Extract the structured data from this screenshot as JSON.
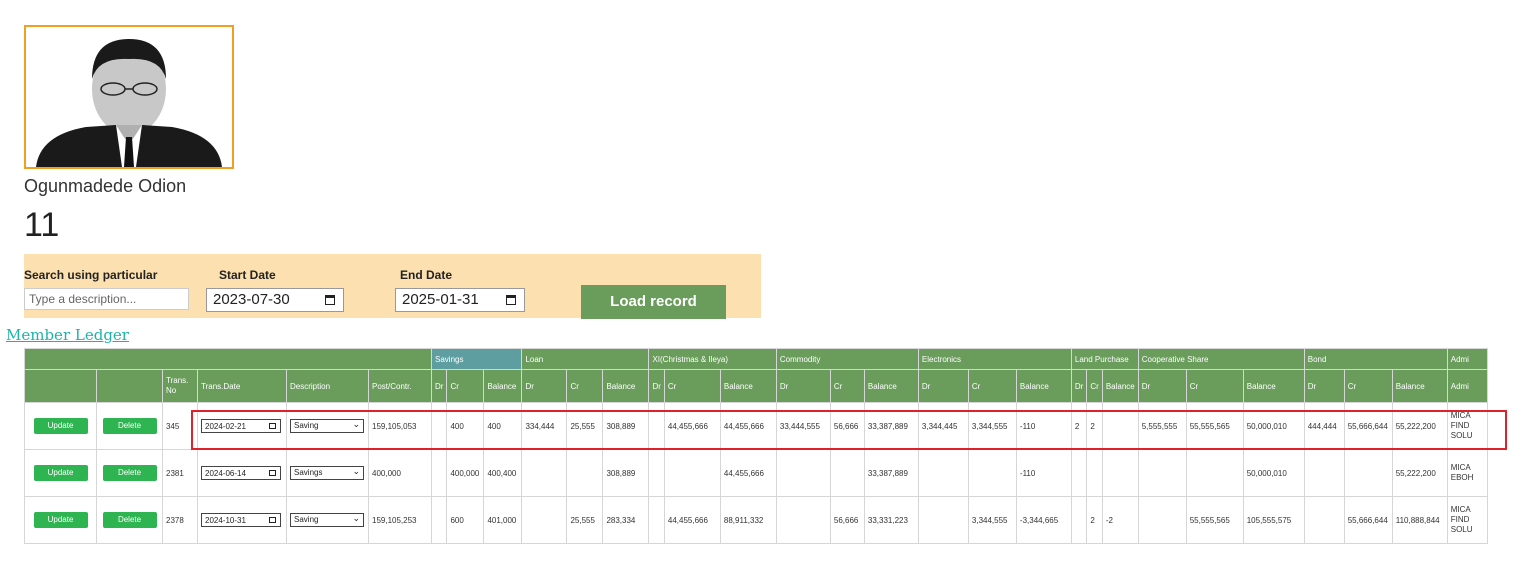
{
  "member": {
    "name": "Ogunmadede Odion",
    "id": "11"
  },
  "filters": {
    "search_label": "Search using particular",
    "search_placeholder": "Type a description...",
    "start_label": "Start Date",
    "start_value": "2023-07-30",
    "end_label": "End Date",
    "end_value": "2025-01-31",
    "load_label": "Load record"
  },
  "ledger_link": "Member Ledger",
  "table": {
    "group_headers": {
      "savings": "Savings",
      "loan": "Loan",
      "xi": "XI(Christmas & Ileya)",
      "commodity": "Commodity",
      "electronics": "Electronics",
      "land": "Land Purchase",
      "coop": "Cooperative Share",
      "bond": "Bond",
      "admin": "Admi"
    },
    "col_headers": {
      "trans_no": "Trans. No",
      "trans_date": "Trans.Date",
      "description": "Description",
      "post": "Post/Contr.",
      "dr": "Dr",
      "cr": "Cr",
      "balance": "Balance",
      "admin": "Admi"
    },
    "update_label": "Update",
    "delete_label": "Delete",
    "rows": [
      {
        "trans_no": "345",
        "date": "2024-02-21",
        "desc": "Saving",
        "post": "159,105,053",
        "sav_dr": "",
        "sav_cr": "400",
        "sav_bal": "400",
        "loan_dr": "334,444",
        "loan_cr": "25,555",
        "loan_bal": "308,889",
        "xi_dr": "",
        "xi_cr": "44,455,666",
        "xi_bal": "44,455,666",
        "com_dr": "33,444,555",
        "com_cr": "56,666",
        "com_bal": "33,387,889",
        "ele_dr": "3,344,445",
        "ele_cr": "3,344,555",
        "ele_bal": "-110",
        "land_dr": "2",
        "land_cr": "2",
        "land_bal": "",
        "coop_dr": "5,555,555",
        "coop_cr": "55,555,565",
        "coop_bal": "50,000,010",
        "bond_dr": "444,444",
        "bond_cr": "55,666,644",
        "bond_bal": "55,222,200",
        "admin": "MICA FIND SOLU"
      },
      {
        "trans_no": "2381",
        "date": "2024-06-14",
        "desc": "Savings",
        "post": "400,000",
        "sav_dr": "",
        "sav_cr": "400,000",
        "sav_bal": "400,400",
        "loan_dr": "",
        "loan_cr": "",
        "loan_bal": "308,889",
        "xi_dr": "",
        "xi_cr": "",
        "xi_bal": "44,455,666",
        "com_dr": "",
        "com_cr": "",
        "com_bal": "33,387,889",
        "ele_dr": "",
        "ele_cr": "",
        "ele_bal": "-110",
        "land_dr": "",
        "land_cr": "",
        "land_bal": "",
        "coop_dr": "",
        "coop_cr": "",
        "coop_bal": "50,000,010",
        "bond_dr": "",
        "bond_cr": "",
        "bond_bal": "55,222,200",
        "admin": "MICA EBOH"
      },
      {
        "trans_no": "2378",
        "date": "2024-10-31",
        "desc": "Saving",
        "post": "159,105,253",
        "sav_dr": "",
        "sav_cr": "600",
        "sav_bal": "401,000",
        "loan_dr": "",
        "loan_cr": "25,555",
        "loan_bal": "283,334",
        "xi_dr": "",
        "xi_cr": "44,455,666",
        "xi_bal": "88,911,332",
        "com_dr": "",
        "com_cr": "56,666",
        "com_bal": "33,331,223",
        "ele_dr": "",
        "ele_cr": "3,344,555",
        "ele_bal": "-3,344,665",
        "land_dr": "",
        "land_cr": "2",
        "land_bal": "-2",
        "coop_dr": "",
        "coop_cr": "55,555,565",
        "coop_bal": "105,555,575",
        "bond_dr": "",
        "bond_cr": "55,666,644",
        "bond_bal": "110,888,844",
        "admin": "MICA FIND SOLU"
      }
    ]
  },
  "colors": {
    "accent_green": "#6a9c5b",
    "button_green": "#2eb551",
    "teal_header": "#5f9ea0",
    "highlight_red": "#e0202a",
    "panel_bg": "#fde0b0"
  }
}
